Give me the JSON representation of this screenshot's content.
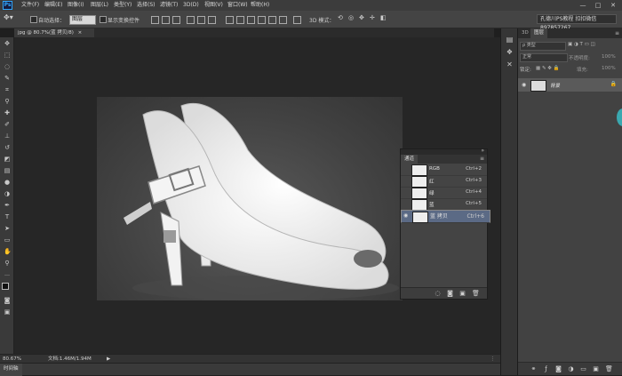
{
  "app": {
    "logo": "Ps"
  },
  "menubar": {
    "items": [
      "文件(F)",
      "编辑(E)",
      "图像(I)",
      "图层(L)",
      "类型(Y)",
      "选择(S)",
      "滤镜(T)",
      "3D(D)",
      "视图(V)",
      "窗口(W)",
      "帮助(H)"
    ],
    "window_controls": {
      "minimize": "—",
      "maximize": "□",
      "close": "✕"
    }
  },
  "options_bar": {
    "auto_select_label": "自动选择：",
    "auto_select_value": "图层",
    "transform_controls_label": "显示变换控件",
    "mode_3d_label": "3D 模式：",
    "workspace": "孔德川PS教程 扣扣微信 897857267"
  },
  "document": {
    "tab_title": "jpg @ 80.7%(蓝 拷贝/8)"
  },
  "statusbar": {
    "zoom": "80.67%",
    "doc_info": "文档:1.46M/1.94M",
    "arrow": "▶"
  },
  "timeline": {
    "label": "时间轴"
  },
  "layers_panel": {
    "tabs": [
      "3D",
      "图层"
    ],
    "kind_label": "ρ 类型",
    "blend_mode": "正常",
    "opacity_label": "不透明度:",
    "opacity_value": "100%",
    "lock_label": "锁定:",
    "fill_label": "填充:",
    "fill_value": "100%",
    "layers": [
      {
        "name": "背景",
        "visible": true,
        "locked": true
      }
    ]
  },
  "channels_panel": {
    "title": "通道",
    "channels": [
      {
        "name": "RGB",
        "shortcut": "Ctrl+2",
        "visible": false,
        "selected": false
      },
      {
        "name": "红",
        "shortcut": "Ctrl+3",
        "visible": false,
        "selected": false
      },
      {
        "name": "绿",
        "shortcut": "Ctrl+4",
        "visible": false,
        "selected": false
      },
      {
        "name": "蓝",
        "shortcut": "Ctrl+5",
        "visible": false,
        "selected": false
      },
      {
        "name": "蓝 拷贝",
        "shortcut": "Ctrl+6",
        "visible": true,
        "selected": true
      }
    ]
  },
  "icons": {
    "toolbar": [
      "move-icon",
      "marquee-icon",
      "lasso-icon",
      "quick-select-icon",
      "crop-icon",
      "eyedropper-icon",
      "healing-icon",
      "brush-icon",
      "stamp-icon",
      "history-brush-icon",
      "eraser-icon",
      "gradient-icon",
      "blur-icon",
      "dodge-icon",
      "pen-icon",
      "type-icon",
      "path-select-icon",
      "shape-icon",
      "hand-icon",
      "zoom-icon"
    ],
    "accent": "#31a8ff",
    "selection": "#5b6a85"
  }
}
